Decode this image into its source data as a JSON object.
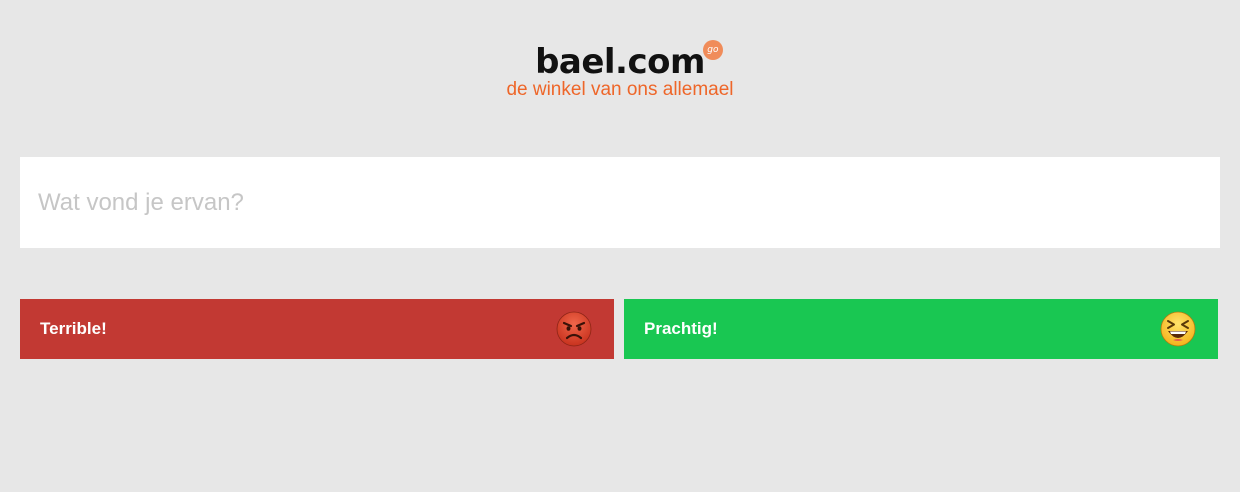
{
  "logo": {
    "wordmark": "bael.com",
    "badge": "go",
    "tagline": "de winkel van ons allemael"
  },
  "feedback": {
    "placeholder": "Wat vond je ervan?",
    "value": ""
  },
  "ratings": [
    {
      "label": "Terrible!",
      "icon": "angry-face-icon",
      "color": "#c23933"
    },
    {
      "label": "Prachtig!",
      "icon": "grinning-squinting-face-icon",
      "color": "#19c752"
    }
  ],
  "colors": {
    "background": "#e7e7e7",
    "accent": "#ee6629"
  }
}
